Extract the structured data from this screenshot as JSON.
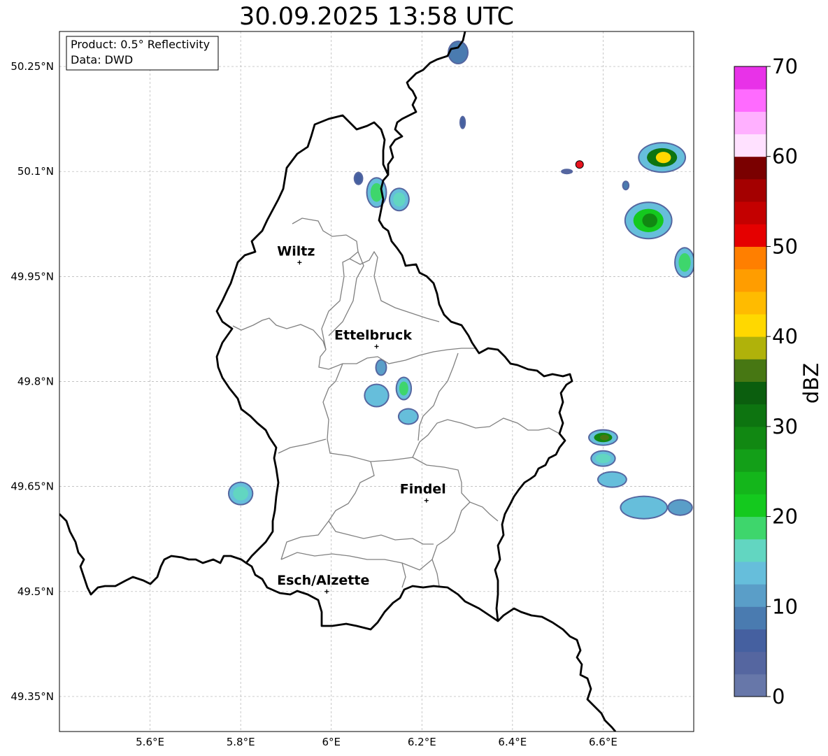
{
  "title": "30.09.2025 13:58 UTC",
  "info_box": {
    "product": "Product: 0.5° Reflectivity",
    "source": "Data: DWD"
  },
  "map": {
    "lon_range": [
      5.4,
      6.8
    ],
    "lat_range": [
      49.3,
      50.3
    ],
    "lat_ticks": [
      {
        "value": 50.25,
        "label": "50.25°N"
      },
      {
        "value": 50.1,
        "label": "50.1°N"
      },
      {
        "value": 49.95,
        "label": "49.95°N"
      },
      {
        "value": 49.8,
        "label": "49.8°N"
      },
      {
        "value": 49.65,
        "label": "49.65°N"
      },
      {
        "value": 49.5,
        "label": "49.5°N"
      },
      {
        "value": 49.35,
        "label": "49.35°N"
      }
    ],
    "lon_ticks": [
      {
        "value": 5.6,
        "label": "5.6°E"
      },
      {
        "value": 5.8,
        "label": "5.8°E"
      },
      {
        "value": 6.0,
        "label": "6°E"
      },
      {
        "value": 6.2,
        "label": "6.2°E"
      },
      {
        "value": 6.4,
        "label": "6.4°E"
      },
      {
        "value": 6.6,
        "label": "6.6°E"
      }
    ],
    "grid": true,
    "cities": [
      {
        "name": "Wiltz",
        "lon": 5.93,
        "lat": 49.97
      },
      {
        "name": "Ettelbruck",
        "lon": 6.1,
        "lat": 49.85
      },
      {
        "name": "Findel",
        "lon": 6.21,
        "lat": 49.63
      },
      {
        "name": "Esch/Alzette",
        "lon": 5.99,
        "lat": 49.5
      }
    ],
    "radar_site": {
      "lon": 6.548,
      "lat": 50.11,
      "color": "#e8141e"
    },
    "echoes": [
      {
        "lon": 6.28,
        "lat": 50.27,
        "dbz": 8,
        "w": 0.04,
        "h": 0.03
      },
      {
        "lon": 6.29,
        "lat": 50.17,
        "dbz": 6,
        "w": 0.008,
        "h": 0.015
      },
      {
        "lon": 6.1,
        "lat": 50.07,
        "dbz": 22,
        "w": 0.04,
        "h": 0.04
      },
      {
        "lon": 6.15,
        "lat": 50.06,
        "dbz": 20,
        "w": 0.04,
        "h": 0.03
      },
      {
        "lon": 6.06,
        "lat": 50.09,
        "dbz": 6,
        "w": 0.015,
        "h": 0.015
      },
      {
        "lon": 6.11,
        "lat": 49.82,
        "dbz": 12,
        "w": 0.02,
        "h": 0.02
      },
      {
        "lon": 6.1,
        "lat": 49.78,
        "dbz": 15,
        "w": 0.05,
        "h": 0.03
      },
      {
        "lon": 6.16,
        "lat": 49.79,
        "dbz": 22,
        "w": 0.03,
        "h": 0.03
      },
      {
        "lon": 6.17,
        "lat": 49.75,
        "dbz": 17,
        "w": 0.04,
        "h": 0.02
      },
      {
        "lon": 5.8,
        "lat": 49.64,
        "dbz": 20,
        "w": 0.05,
        "h": 0.03
      },
      {
        "lon": 6.73,
        "lat": 50.12,
        "dbz": 40,
        "w": 0.1,
        "h": 0.04
      },
      {
        "lon": 6.7,
        "lat": 50.03,
        "dbz": 28,
        "w": 0.1,
        "h": 0.05
      },
      {
        "lon": 6.78,
        "lat": 49.97,
        "dbz": 22,
        "w": 0.04,
        "h": 0.04
      },
      {
        "lon": 6.6,
        "lat": 49.72,
        "dbz": 36,
        "w": 0.06,
        "h": 0.02
      },
      {
        "lon": 6.6,
        "lat": 49.69,
        "dbz": 20,
        "w": 0.05,
        "h": 0.02
      },
      {
        "lon": 6.62,
        "lat": 49.66,
        "dbz": 18,
        "w": 0.06,
        "h": 0.02
      },
      {
        "lon": 6.69,
        "lat": 49.62,
        "dbz": 18,
        "w": 0.1,
        "h": 0.03
      },
      {
        "lon": 6.77,
        "lat": 49.62,
        "dbz": 12,
        "w": 0.05,
        "h": 0.02
      },
      {
        "lon": 6.65,
        "lat": 50.08,
        "dbz": 8,
        "w": 0.01,
        "h": 0.01
      },
      {
        "lon": 6.52,
        "lat": 50.1,
        "dbz": 4,
        "w": 0.02,
        "h": 0.004
      }
    ]
  },
  "colorbar": {
    "label": "dBZ",
    "min": 0,
    "max": 70,
    "ticks": [
      "0",
      "10",
      "20",
      "30",
      "40",
      "50",
      "60",
      "70"
    ],
    "colors": [
      "#6777a9",
      "#5566a0",
      "#4560a0",
      "#4a7bb0",
      "#5a9ec8",
      "#66bedb",
      "#62d6c1",
      "#3ed66c",
      "#14c91e",
      "#14b61b",
      "#139f18",
      "#118812",
      "#0d7410",
      "#0b5e0e",
      "#477713",
      "#b0b20a",
      "#ffd800",
      "#ffbb00",
      "#ff9d00",
      "#ff7f00",
      "#e50000",
      "#c40000",
      "#a40000",
      "#7a0000",
      "#ffe1ff",
      "#ffb0ff",
      "#ff6bff",
      "#e832e8"
    ]
  }
}
